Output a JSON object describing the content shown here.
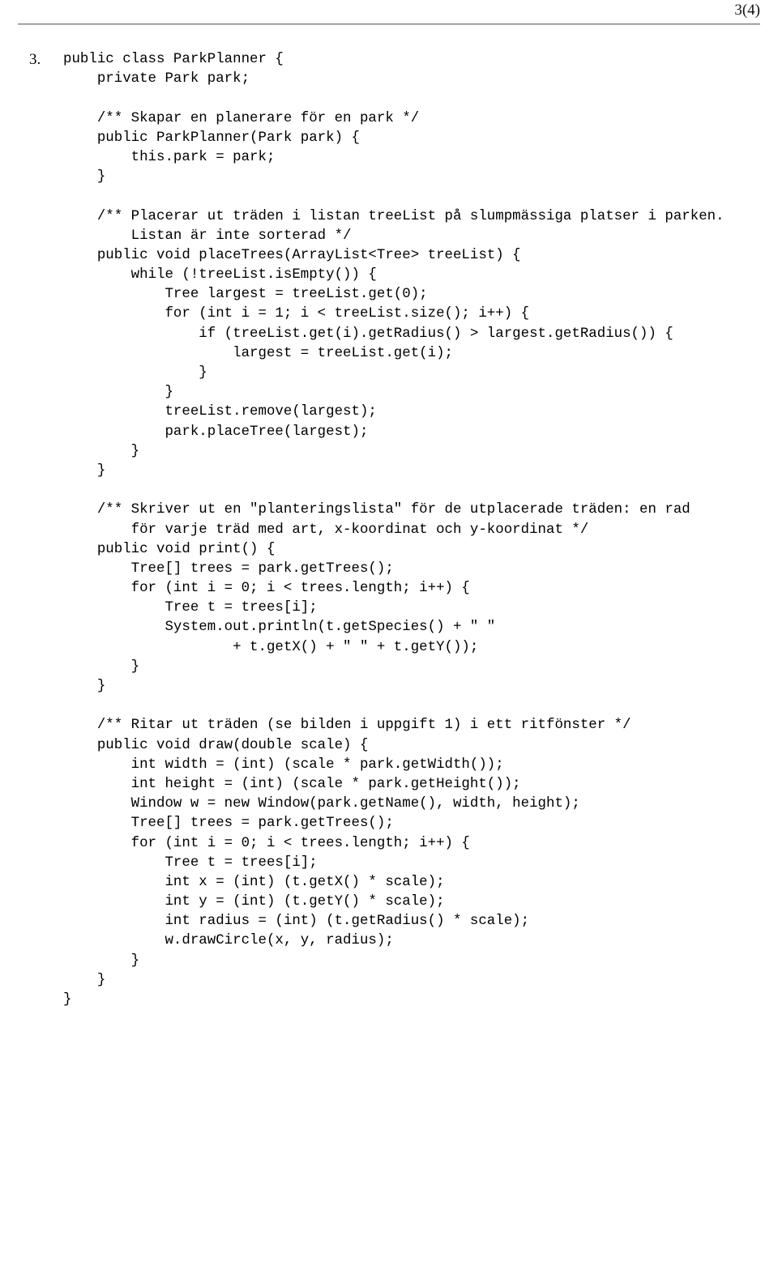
{
  "document": {
    "page_label": "3(4)",
    "item_marker": "3.",
    "language": "java"
  },
  "code": {
    "lines": [
      "public class ParkPlanner {",
      "    private Park park;",
      "",
      "    /** Skapar en planerare för en park */",
      "    public ParkPlanner(Park park) {",
      "        this.park = park;",
      "    }",
      "",
      "    /** Placerar ut träden i listan treeList på slumpmässiga platser i parken.",
      "        Listan är inte sorterad */",
      "    public void placeTrees(ArrayList<Tree> treeList) {",
      "        while (!treeList.isEmpty()) {",
      "            Tree largest = treeList.get(0);",
      "            for (int i = 1; i < treeList.size(); i++) {",
      "                if (treeList.get(i).getRadius() > largest.getRadius()) {",
      "                    largest = treeList.get(i);",
      "                }",
      "            }",
      "            treeList.remove(largest);",
      "            park.placeTree(largest);",
      "        }",
      "    }",
      "",
      "    /** Skriver ut en \"planteringslista\" för de utplacerade träden: en rad",
      "        för varje träd med art, x-koordinat och y-koordinat */",
      "    public void print() {",
      "        Tree[] trees = park.getTrees();",
      "        for (int i = 0; i < trees.length; i++) {",
      "            Tree t = trees[i];",
      "            System.out.println(t.getSpecies() + \" \"",
      "                    + t.getX() + \" \" + t.getY());",
      "        }",
      "    }",
      "",
      "    /** Ritar ut träden (se bilden i uppgift 1) i ett ritfönster */",
      "    public void draw(double scale) {",
      "        int width = (int) (scale * park.getWidth());",
      "        int height = (int) (scale * park.getHeight());",
      "        Window w = new Window(park.getName(), width, height);",
      "        Tree[] trees = park.getTrees();",
      "        for (int i = 0; i < trees.length; i++) {",
      "            Tree t = trees[i];",
      "            int x = (int) (t.getX() * scale);",
      "            int y = (int) (t.getY() * scale);",
      "            int radius = (int) (t.getRadius() * scale);",
      "            w.drawCircle(x, y, radius);",
      "        }",
      "    }",
      "}"
    ]
  }
}
